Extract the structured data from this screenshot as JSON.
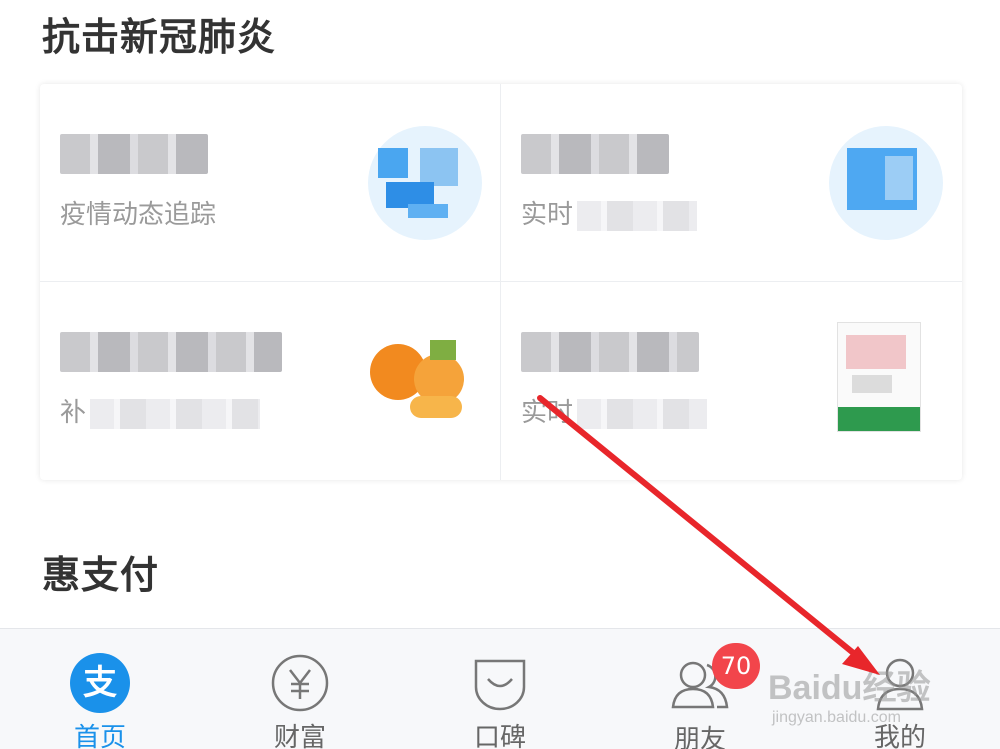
{
  "sections": {
    "covid_title": "抗击新冠肺炎",
    "pay_title": "惠支付"
  },
  "cards": [
    {
      "subtitle": "疫情动态追踪",
      "icon": "china-map-icon"
    },
    {
      "subtitle": "实时",
      "icon": "folder-icon"
    },
    {
      "subtitle": "补",
      "icon": "orange-fruit-icon"
    },
    {
      "subtitle": "实时",
      "icon": "medicine-box-icon"
    }
  ],
  "nav": {
    "items": [
      {
        "label": "首页",
        "icon": "alipay-logo-icon",
        "active": true
      },
      {
        "label": "财富",
        "icon": "yen-coin-icon"
      },
      {
        "label": "口碑",
        "icon": "koubei-icon"
      },
      {
        "label": "朋友",
        "icon": "friends-icon",
        "badge": "70"
      },
      {
        "label": "我的",
        "icon": "person-icon"
      }
    ],
    "brand_glyph": "支"
  },
  "watermark": {
    "main": "Baidu经验",
    "sub": "jingyan.baidu.com"
  },
  "colors": {
    "accent": "#1a91ea",
    "badge": "#f2454b",
    "arrow": "#e8262b"
  }
}
